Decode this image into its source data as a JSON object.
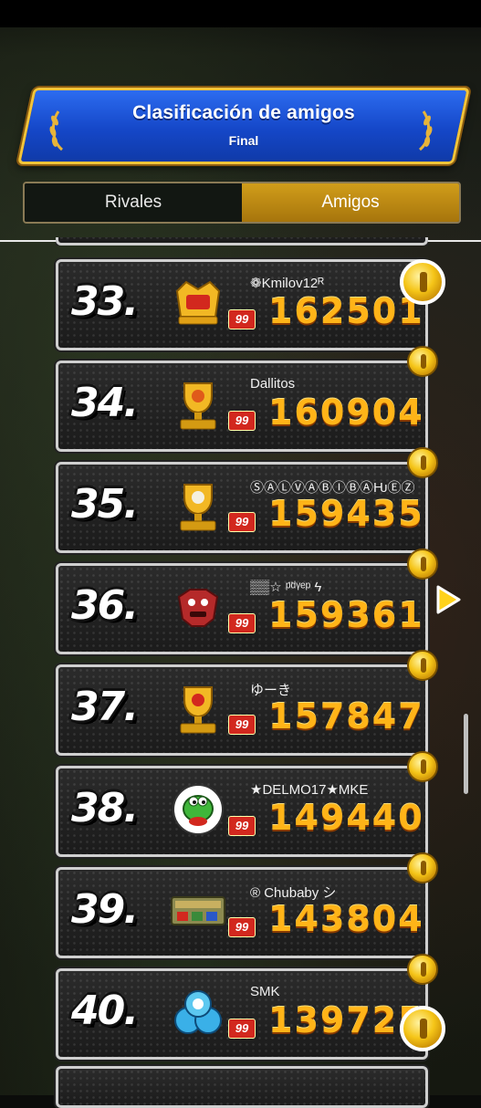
{
  "header": {
    "title": "Clasificación de amigos",
    "subtitle": "Final"
  },
  "tabs": [
    {
      "label": "Rivales",
      "active": false
    },
    {
      "label": "Amigos",
      "active": true
    }
  ],
  "colors": {
    "accent": "#f3c43a",
    "banner": "#1a4fd6",
    "score": "#ffb418",
    "level_badge": "#d2281e"
  },
  "entries": [
    {
      "rank": "33.",
      "name": "❁Kmilov12ᴿ",
      "level": "99",
      "score": "162501",
      "emblem": "gold-crown-emblem-icon"
    },
    {
      "rank": "34.",
      "name": "Dallitos",
      "level": "99",
      "score": "160904",
      "emblem": "top-1000-trophy-icon"
    },
    {
      "rank": "35.",
      "name": "ⓈⒶⓁⓋⒶⒷⒾⒷⒶǶⒺⓏ",
      "level": "99",
      "score": "159435",
      "emblem": "top-1000-trophy-icon"
    },
    {
      "rank": "36.",
      "name": "▒▒☆ ᵖ̈ᵈᵞᵉᵖ ϟ",
      "level": "99",
      "score": "159361",
      "emblem": "red-kong-emblem-icon"
    },
    {
      "rank": "37.",
      "name": "ゆーき",
      "level": "99",
      "score": "157847",
      "emblem": "top-1000-trophy-icon"
    },
    {
      "rank": "38.",
      "name": "★DELMO17★MKE",
      "level": "99",
      "score": "149440",
      "emblem": "yoshi-emblem-icon"
    },
    {
      "rank": "39.",
      "name": "® Chubaby シ",
      "level": "99",
      "score": "143804",
      "emblem": "special-cup-emblem-icon"
    },
    {
      "rank": "40.",
      "name": "SMK",
      "level": "99",
      "score": "139725",
      "emblem": "blue-shell-emblem-icon"
    }
  ]
}
